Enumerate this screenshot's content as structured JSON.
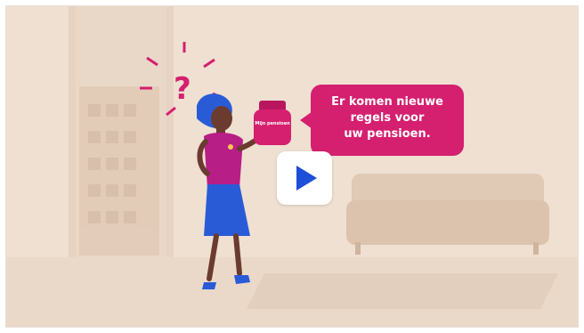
{
  "video": {
    "speech_bubble": {
      "line1": "Er komen nieuwe",
      "line2": "regels voor",
      "line3": "uw pensioen."
    },
    "play_button": {
      "icon": "play-icon"
    },
    "jar_label": "Mijn pensioen"
  },
  "colors": {
    "background": "#efe0d0",
    "accent": "#d51f6f",
    "play_icon": "#1e4fd8"
  }
}
